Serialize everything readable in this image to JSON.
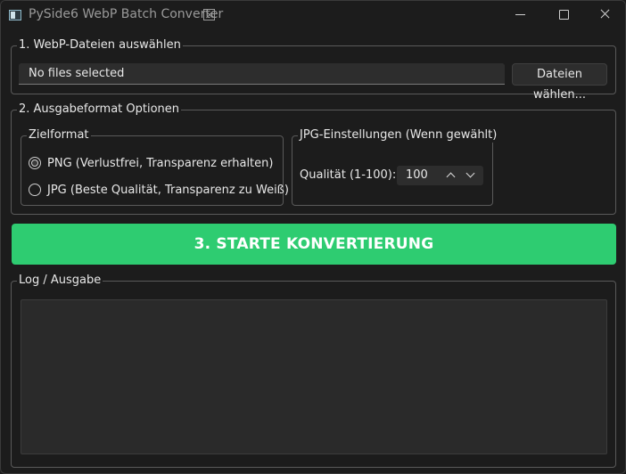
{
  "window": {
    "title": "PySide6 WebP Batch Converter"
  },
  "files_group": {
    "title": "1. WebP-Dateien auswählen",
    "field_value": "No files selected",
    "choose_label": "Dateien wählen..."
  },
  "output_group": {
    "title": "2. Ausgabeformat  Optionen",
    "format_group": {
      "title": "Zielformat",
      "options": [
        {
          "label": "PNG (Verlustfrei, Transparenz erhalten)",
          "checked": true
        },
        {
          "label": "JPG (Beste Qualität, Transparenz zu Weiß)",
          "checked": false
        }
      ]
    },
    "jpg_group": {
      "title": "JPG-Einstellungen (Wenn gewählt)",
      "quality_label": "Qualität (1-100):",
      "quality_value": "100"
    }
  },
  "start_button": {
    "label": "3. STARTE KONVERTIERUNG",
    "color": "#2ecc71"
  },
  "log_group": {
    "title": "Log / Ausgabe"
  }
}
